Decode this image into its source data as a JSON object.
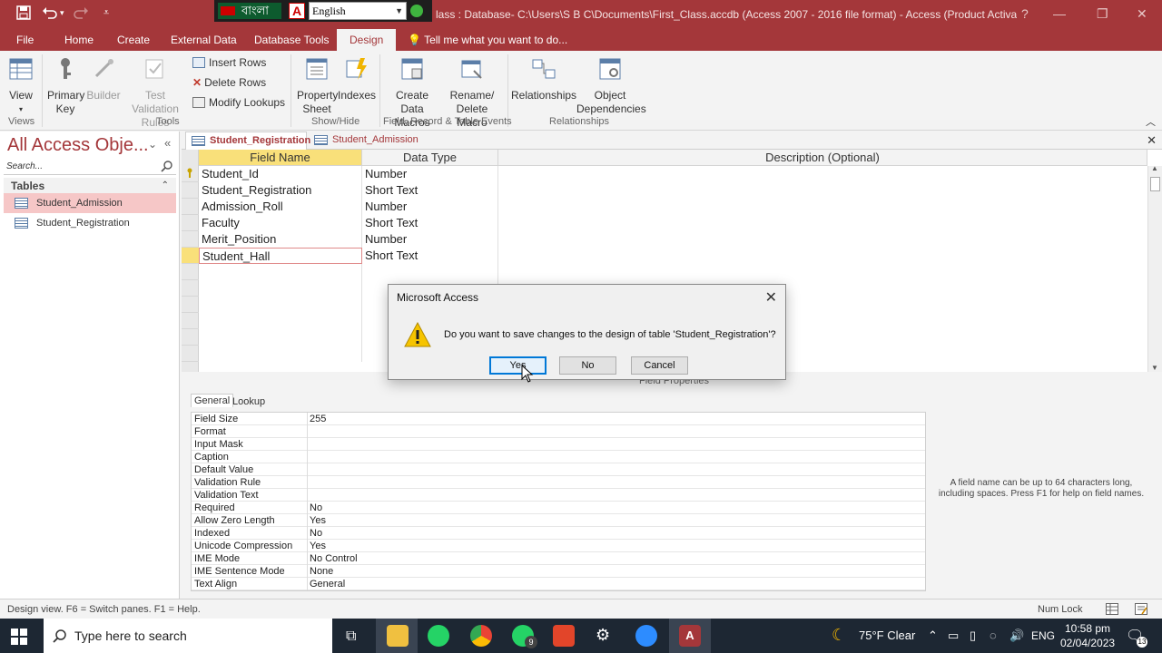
{
  "window": {
    "title": "lass : Database- C:\\Users\\S B C\\Documents\\First_Class.accdb (Access 2007 - 2016 file format) - Access (Product Activation F...",
    "lang_bengali": "বাংলা",
    "lang_combo": "English"
  },
  "ribbon_tabs": [
    "File",
    "Home",
    "Create",
    "External Data",
    "Database Tools",
    "Design"
  ],
  "tell_me": "Tell me what you want to do...",
  "ribbon": {
    "view": "View",
    "primary_key": "Primary Key",
    "builder": "Builder",
    "test_validation": "Test Validation Rules",
    "insert_rows": "Insert Rows",
    "delete_rows": "Delete Rows",
    "modify_lookups": "Modify Lookups",
    "property_sheet": "Property Sheet",
    "indexes": "Indexes",
    "create_data_macros": "Create Data Macros",
    "rename_delete_macro": "Rename/ Delete Macro",
    "relationships": "Relationships",
    "object_dependencies": "Object Dependencies",
    "groups": [
      "Views",
      "Tools",
      "Show/Hide",
      "Field, Record & Table Events",
      "Relationships"
    ]
  },
  "nav": {
    "header": "All Access Obje...",
    "search_placeholder": "Search...",
    "section": "Tables",
    "items": [
      "Student_Admission",
      "Student_Registration"
    ]
  },
  "doc_tabs": [
    "Student_Registration",
    "Student_Admission"
  ],
  "grid": {
    "headers": [
      "Field Name",
      "Data Type",
      "Description (Optional)"
    ],
    "rows": [
      {
        "name": "Student_Id",
        "type": "Number"
      },
      {
        "name": "Student_Registration",
        "type": "Short Text"
      },
      {
        "name": "Admission_Roll",
        "type": "Number"
      },
      {
        "name": "Faculty",
        "type": "Short Text"
      },
      {
        "name": "Merit_Position",
        "type": "Number"
      },
      {
        "name": "Student_Hall",
        "type": "Short Text"
      }
    ]
  },
  "field_properties": {
    "label": "Field Properties",
    "tabs": [
      "General",
      "Lookup"
    ],
    "rows": [
      {
        "name": "Field Size",
        "value": "255"
      },
      {
        "name": "Format",
        "value": ""
      },
      {
        "name": "Input Mask",
        "value": ""
      },
      {
        "name": "Caption",
        "value": ""
      },
      {
        "name": "Default Value",
        "value": ""
      },
      {
        "name": "Validation Rule",
        "value": ""
      },
      {
        "name": "Validation Text",
        "value": ""
      },
      {
        "name": "Required",
        "value": "No"
      },
      {
        "name": "Allow Zero Length",
        "value": "Yes"
      },
      {
        "name": "Indexed",
        "value": "No"
      },
      {
        "name": "Unicode Compression",
        "value": "Yes"
      },
      {
        "name": "IME Mode",
        "value": "No Control"
      },
      {
        "name": "IME Sentence Mode",
        "value": "None"
      },
      {
        "name": "Text Align",
        "value": "General"
      }
    ],
    "help": "A field name can be up to 64 characters long, including spaces. Press F1 for help on field names."
  },
  "status": {
    "left": "Design view.  F6 = Switch panes.  F1 = Help.",
    "right": "Num Lock"
  },
  "dialog": {
    "title": "Microsoft Access",
    "message": "Do you want to save changes to the design of table 'Student_Registration'?",
    "yes": "Yes",
    "no": "No",
    "cancel": "Cancel"
  },
  "taskbar": {
    "search": "Type here to search",
    "weather": "75°F  Clear",
    "lang": "ENG",
    "time": "10:58 pm",
    "date": "02/04/2023",
    "whatsapp_badge": "9",
    "notification_count": "13"
  },
  "colors": {
    "accent": "#a4373a",
    "field_name_header": "#f9e07a",
    "nav_selected": "#f6c7c7",
    "taskbar": "#1d2733"
  }
}
